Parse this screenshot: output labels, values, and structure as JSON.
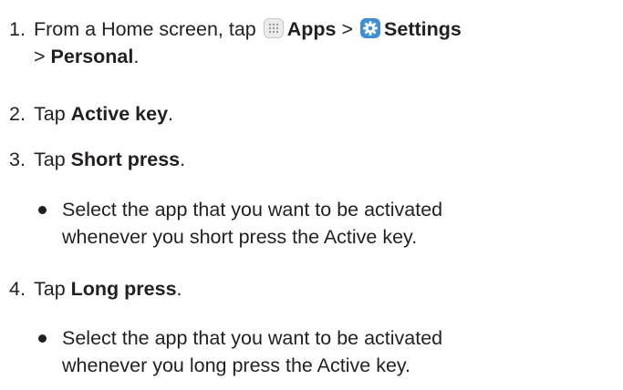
{
  "steps": [
    {
      "number": "1.",
      "pre": "From a Home screen, tap",
      "apps_label": "Apps",
      "sep1": ">",
      "settings_label": "Settings",
      "sep2": ">",
      "personal_label": "Personal",
      "end": ".",
      "icons": [
        "apps-grid-icon",
        "settings-gear-icon"
      ]
    },
    {
      "number": "2.",
      "pre": "Tap",
      "bold": "Active key",
      "end": "."
    },
    {
      "number": "3.",
      "pre": "Tap",
      "bold": "Short press",
      "end": "."
    },
    {
      "number": "4.",
      "pre": "Tap",
      "bold": "Long press",
      "end": "."
    }
  ],
  "bullets": [
    {
      "line1": "Select the app that you want to be activated",
      "line2": "whenever you short press the Active key."
    },
    {
      "line1": "Select the app that you want to be activated",
      "line2": "whenever you long press the Active key."
    }
  ],
  "colors": {
    "text": "#231f20",
    "settings_icon_bg": "#3f8fd8",
    "apps_icon_bg": "#ececec"
  }
}
